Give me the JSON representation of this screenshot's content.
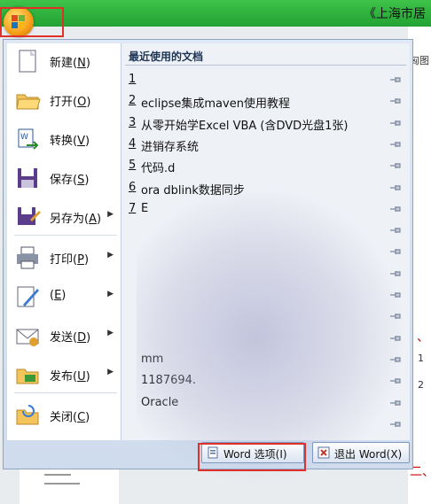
{
  "window": {
    "title": "《上海市居"
  },
  "office_button": {
    "icon": "office-logo-icon"
  },
  "menu": {
    "left_items": [
      {
        "label": "新建",
        "key": "N",
        "icon": "new-document-icon",
        "submenu": false
      },
      {
        "label": "打开",
        "key": "O",
        "icon": "open-folder-icon",
        "submenu": false
      },
      {
        "label": "转换",
        "key": "V",
        "icon": "convert-icon",
        "submenu": false
      },
      {
        "label": "保存",
        "key": "S",
        "icon": "save-icon",
        "submenu": false
      },
      {
        "label": "另存为",
        "key": "A",
        "icon": "save-as-icon",
        "submenu": true
      },
      {
        "label": "打印",
        "key": "P",
        "icon": "print-icon",
        "submenu": true
      },
      {
        "label": "",
        "key": "E",
        "icon": "prepare-icon",
        "submenu": true
      },
      {
        "label": "发送",
        "key": "D",
        "icon": "send-icon",
        "submenu": true
      },
      {
        "label": "发布",
        "key": "U",
        "icon": "publish-icon",
        "submenu": true
      },
      {
        "label": "关闭",
        "key": "C",
        "icon": "close-doc-icon",
        "submenu": false
      }
    ],
    "recent": {
      "header": "最近使用的文档",
      "items": [
        {
          "idx": "1",
          "name": ""
        },
        {
          "idx": "2",
          "name": "eclipse集成maven使用教程"
        },
        {
          "idx": "3",
          "name": "从零开始学Excel VBA (含DVD光盘1张)"
        },
        {
          "idx": "4",
          "name": "进销存系统"
        },
        {
          "idx": "5",
          "name": "代码.d"
        },
        {
          "idx": "6",
          "name": "ora     dblink数据同步"
        },
        {
          "idx": "7",
          "name": "E"
        },
        {
          "idx": "",
          "name": ""
        },
        {
          "idx": "",
          "name": ""
        },
        {
          "idx": "",
          "name": ""
        },
        {
          "idx": "",
          "name": ""
        },
        {
          "idx": "",
          "name": ""
        },
        {
          "idx": "",
          "name": ""
        },
        {
          "idx": "",
          "name": "mm"
        },
        {
          "idx": "",
          "name": "1187694."
        },
        {
          "idx": "",
          "name": "Oracle"
        },
        {
          "idx": "",
          "name": ""
        }
      ]
    },
    "buttons": {
      "options": {
        "label": "Word 选项(I)",
        "icon": "word-options-icon"
      },
      "exit": {
        "label": "退出 Word(X)",
        "icon": "exit-icon"
      }
    }
  },
  "side_texts": [
    "匈图",
    "1",
    "2"
  ],
  "colors": {
    "accent": "#23a233",
    "highlight": "#e0302a",
    "menu_bg": "#dfe8f4"
  }
}
